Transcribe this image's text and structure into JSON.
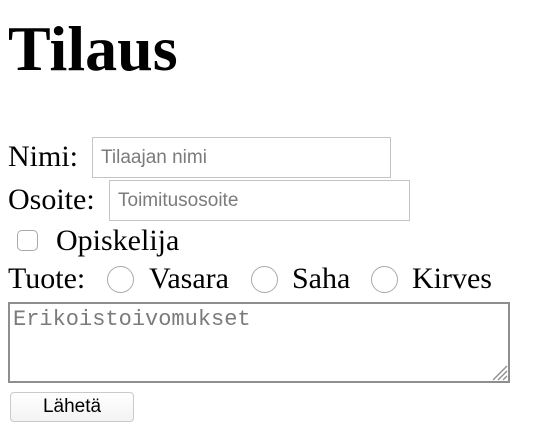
{
  "page": {
    "title": "Tilaus"
  },
  "form": {
    "name": {
      "label": "Nimi:",
      "placeholder": "Tilaajan nimi",
      "value": ""
    },
    "address": {
      "label": "Osoite:",
      "placeholder": "Toimitusosoite",
      "value": ""
    },
    "student": {
      "label": "Opiskelija",
      "checked": false
    },
    "product": {
      "label": "Tuote:",
      "options": [
        {
          "label": "Vasara",
          "selected": false
        },
        {
          "label": "Saha",
          "selected": false
        },
        {
          "label": "Kirves",
          "selected": false
        }
      ]
    },
    "requests": {
      "placeholder": "Erikoistoivomukset",
      "value": ""
    },
    "submit_label": "Lähetä"
  }
}
